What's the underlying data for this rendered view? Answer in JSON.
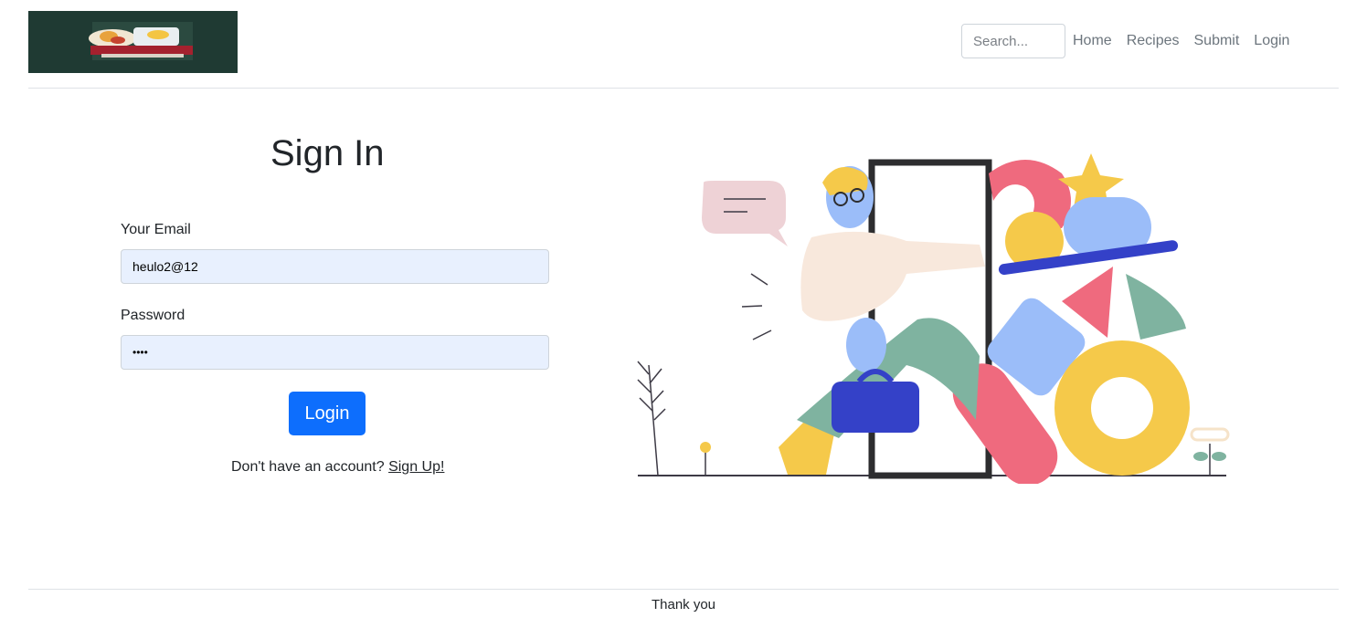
{
  "header": {
    "logo_alt": "food logo",
    "search": {
      "placeholder": "Search...",
      "value": ""
    },
    "nav": [
      "Home",
      "Recipes",
      "Submit",
      "Login"
    ]
  },
  "signin": {
    "title": "Sign In",
    "email_label": "Your Email",
    "email_value": "heulo2@12",
    "password_label": "Password",
    "password_value": "••••",
    "login_button": "Login",
    "signup_prompt": "Don't have an account? ",
    "signup_link": "Sign Up!"
  },
  "footer": {
    "text": "Thank you"
  },
  "colors": {
    "primary": "#0d6efd",
    "input_autofill_bg": "#e8f0fe",
    "logo_bg": "#1f3a33"
  }
}
